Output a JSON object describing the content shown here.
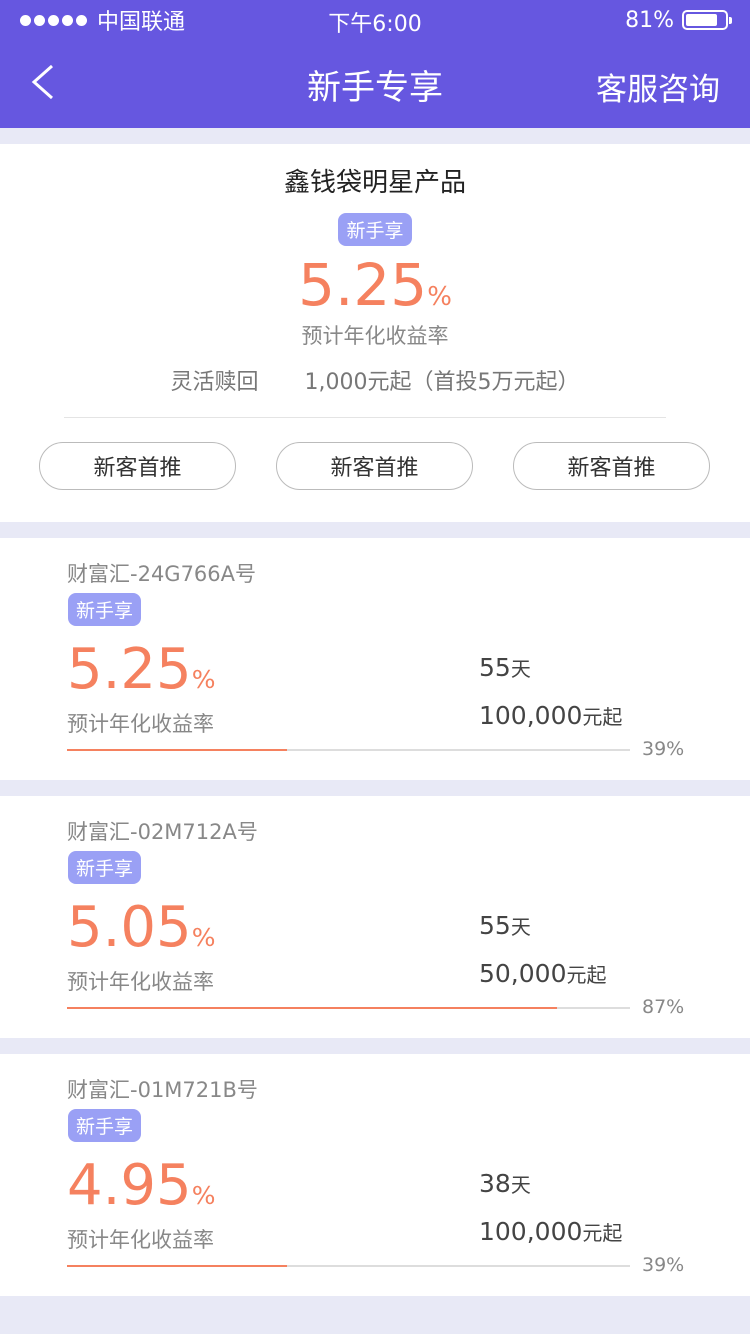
{
  "status_bar": {
    "carrier": "中国联通",
    "time": "下午6:00",
    "battery": "81%"
  },
  "nav": {
    "title": "新手专享",
    "right_action": "客服咨询"
  },
  "hero": {
    "name": "鑫钱袋明星产品",
    "tag": "新手享",
    "rate": "5.25",
    "rate_unit": "%",
    "rate_label": "预计年化收益率",
    "redeem": "灵活赎回",
    "min_invest": "1,000元起（首投5万元起）",
    "buttons": [
      "新客首推",
      "新客首推",
      "新客首推"
    ]
  },
  "products": [
    {
      "name": "财富汇-24G766A号",
      "tag": "新手享",
      "rate": "5.25",
      "rate_unit": "%",
      "rate_label": "预计年化收益率",
      "days": "55",
      "days_unit": "天",
      "amount": "100,000",
      "amount_unit": "元起",
      "progress": 0.39,
      "progress_text": "39%"
    },
    {
      "name": "财富汇-02M712A号",
      "tag": "新手享",
      "rate": "5.05",
      "rate_unit": "%",
      "rate_label": "预计年化收益率",
      "days": "55",
      "days_unit": "天",
      "amount": "50,000",
      "amount_unit": "元起",
      "progress": 0.87,
      "progress_text": "87%"
    },
    {
      "name": "财富汇-01M721B号",
      "tag": "新手享",
      "rate": "4.95",
      "rate_unit": "%",
      "rate_label": "预计年化收益率",
      "days": "38",
      "days_unit": "天",
      "amount": "100,000",
      "amount_unit": "元起",
      "progress": 0.39,
      "progress_text": "39%"
    }
  ],
  "colors": {
    "header": "#6657e0",
    "accent": "#f5815f",
    "tag": "#9aa0f5",
    "background": "#e8e9f6"
  }
}
